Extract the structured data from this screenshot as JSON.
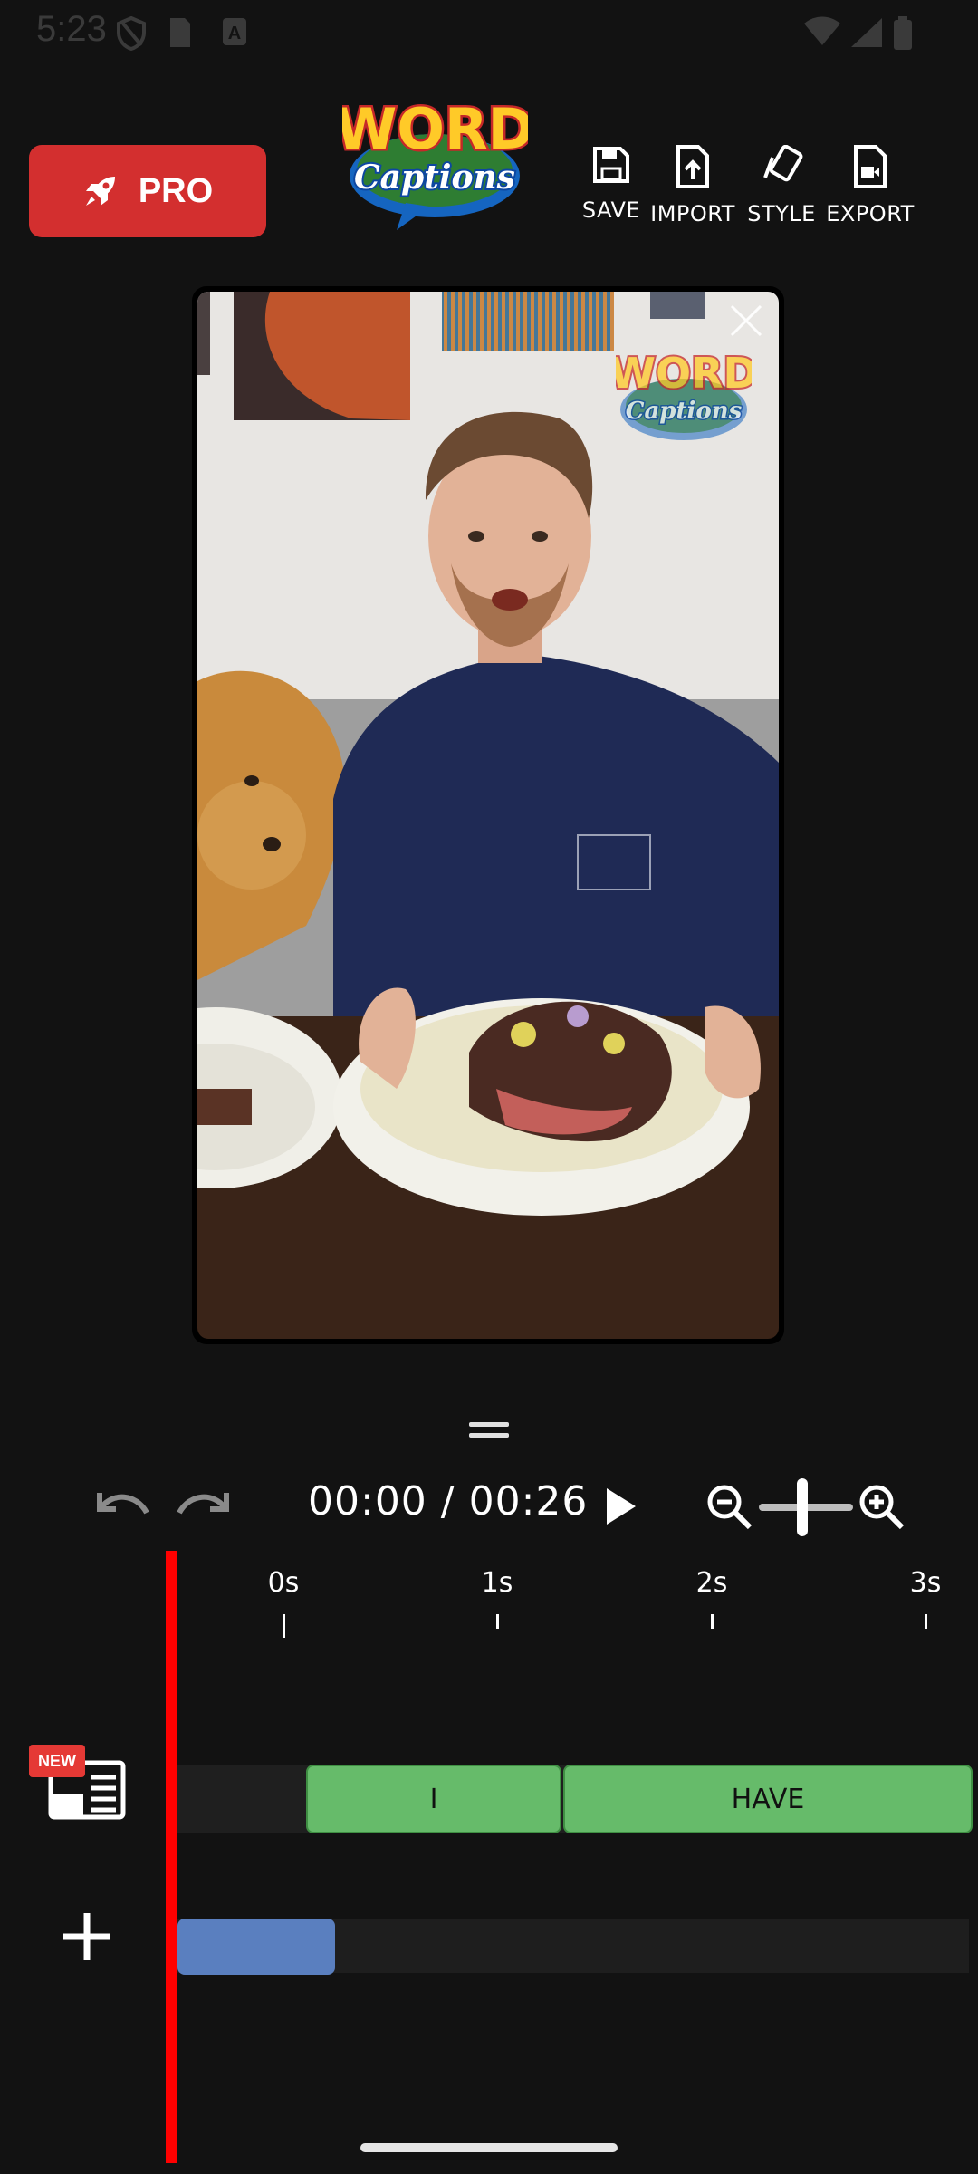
{
  "status_bar": {
    "time": "5:23"
  },
  "header": {
    "pro_label": "PRO",
    "logo_text_top": "WORD",
    "logo_text_bottom": "Captions",
    "toolbar": [
      {
        "label": "SAVE",
        "icon": "save-icon"
      },
      {
        "label": "IMPORT",
        "icon": "import-icon"
      },
      {
        "label": "STYLE",
        "icon": "style-icon"
      },
      {
        "label": "EXPORT",
        "icon": "export-icon"
      }
    ]
  },
  "preview": {
    "watermark_top": "WORD",
    "watermark_bottom": "Captions"
  },
  "controls": {
    "timecode": "00:00 / 00:26"
  },
  "timeline": {
    "ruler": [
      "0s",
      "1s",
      "2s",
      "3s"
    ],
    "captions": [
      {
        "word": "I"
      },
      {
        "word": "HAVE"
      }
    ],
    "new_badge": "NEW"
  },
  "colors": {
    "background": "#121212",
    "pro_red": "#d32f2f",
    "clip_green": "#66bb6a",
    "audio_blue": "#5a7fbf",
    "playhead_red": "#ff0000"
  }
}
